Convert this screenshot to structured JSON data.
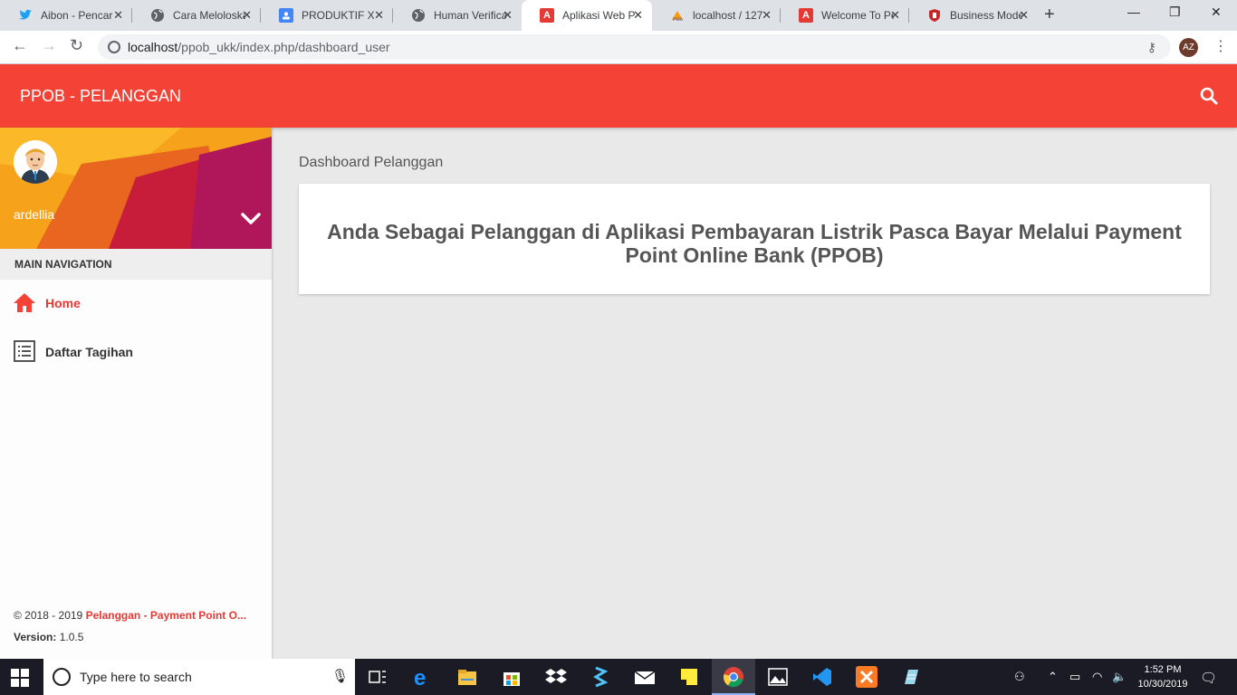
{
  "browser": {
    "tabs": [
      {
        "title": "Aibon - Pencar",
        "icon": "twitter-icon",
        "active": false
      },
      {
        "title": "Cara Meloloskan",
        "icon": "globe-icon",
        "active": false
      },
      {
        "title": "PRODUKTIF XII",
        "icon": "contact-icon",
        "active": false
      },
      {
        "title": "Human Verificat",
        "icon": "globe-icon",
        "active": false
      },
      {
        "title": "Aplikasi Web P",
        "icon": "app-a-icon",
        "active": true
      },
      {
        "title": "localhost / 127",
        "icon": "phpmyadmin-icon",
        "active": false
      },
      {
        "title": "Welcome To Pe",
        "icon": "app-a-icon",
        "active": false
      },
      {
        "title": "Business Mode",
        "icon": "shield-icon",
        "active": false
      }
    ],
    "url_host": "localhost",
    "url_path": "/ppob_ukk/index.php/dashboard_user",
    "profile_initials": "AZ",
    "new_tab_glyph": "+"
  },
  "header": {
    "title": "PPOB - PELANGGAN"
  },
  "sidebar": {
    "username": "ardellia",
    "nav_header": "MAIN NAVIGATION",
    "items": [
      {
        "label": "Home",
        "icon": "home-icon",
        "active": true
      },
      {
        "label": "Daftar Tagihan",
        "icon": "list-icon",
        "active": false
      }
    ],
    "footer": {
      "copyright": "© 2018 - 2019 ",
      "brand": "Pelanggan - Payment Point O...",
      "version_label": "Version:",
      "version_value": " 1.0.5"
    }
  },
  "main": {
    "breadcrumb": "Dashboard Pelanggan",
    "card_text": "Anda Sebagai Pelanggan di Aplikasi Pembayaran Listrik Pasca Bayar Melalui Payment Point Online Bank (PPOB)"
  },
  "taskbar": {
    "search_placeholder": "Type here to search",
    "time": "1:52 PM",
    "date": "10/30/2019"
  },
  "colors": {
    "accent": "#f44336",
    "active_nav": "#e53935"
  }
}
